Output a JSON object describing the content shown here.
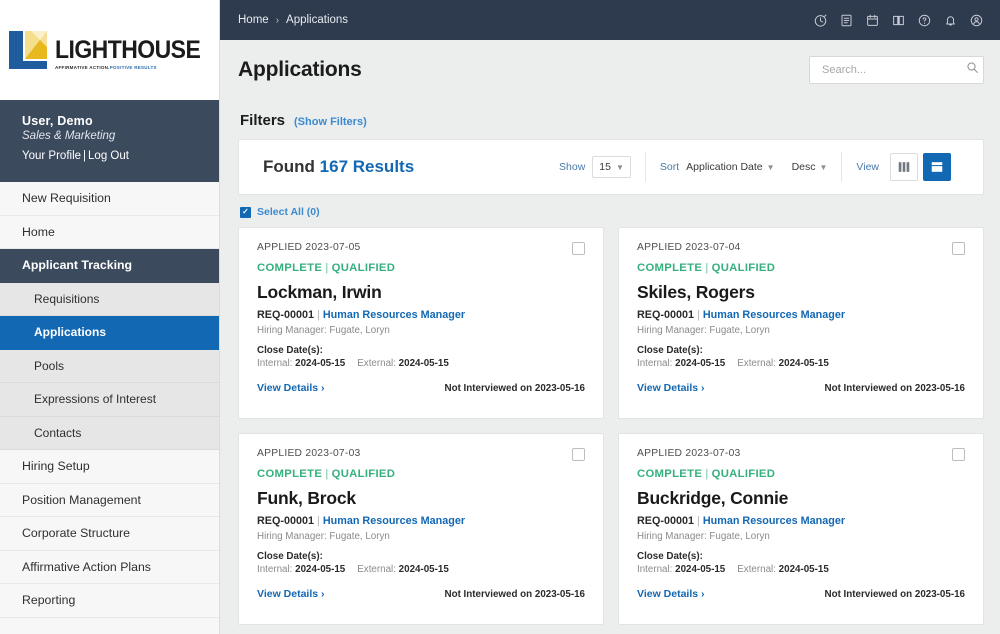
{
  "brand": {
    "word": "LIGHTHOUSE",
    "tagline_dark": "AFFIRMATIVE ACTION.",
    "tagline_blue": "POSITIVE RESULTS",
    "logo_icon": "lighthouse-logo-icon",
    "colors": {
      "navy": "#3c4a5e",
      "blue": "#1268b3",
      "gold": "#e8b81f",
      "green": "#35b07e"
    }
  },
  "user": {
    "name": "User, Demo",
    "department": "Sales & Marketing",
    "profile_link": "Your Profile",
    "separator": "|",
    "logout_link": "Log Out"
  },
  "sidebar": {
    "items": [
      {
        "label": "New Requisition",
        "type": "top",
        "state": "normal"
      },
      {
        "label": "Home",
        "type": "top",
        "state": "normal"
      },
      {
        "label": "Applicant Tracking",
        "type": "top",
        "state": "section-active"
      },
      {
        "label": "Requisitions",
        "type": "sub",
        "state": "normal"
      },
      {
        "label": "Applications",
        "type": "sub",
        "state": "active"
      },
      {
        "label": "Pools",
        "type": "sub",
        "state": "normal"
      },
      {
        "label": "Expressions of Interest",
        "type": "sub",
        "state": "normal"
      },
      {
        "label": "Contacts",
        "type": "sub",
        "state": "normal"
      },
      {
        "label": "Hiring Setup",
        "type": "top",
        "state": "normal"
      },
      {
        "label": "Position Management",
        "type": "top",
        "state": "normal"
      },
      {
        "label": "Corporate Structure",
        "type": "top",
        "state": "normal"
      },
      {
        "label": "Affirmative Action Plans",
        "type": "top",
        "state": "normal"
      },
      {
        "label": "Reporting",
        "type": "top",
        "state": "normal"
      }
    ]
  },
  "topbar": {
    "breadcrumb": [
      "Home",
      "Applications"
    ],
    "separator": "›",
    "icons": [
      "timer-icon",
      "documents-icon",
      "calendar-icon",
      "book-icon",
      "help-circle-icon",
      "bell-icon",
      "account-settings-icon"
    ]
  },
  "page": {
    "title": "Applications"
  },
  "search": {
    "placeholder": "Search...",
    "value": "",
    "icon": "search-icon"
  },
  "filters": {
    "label": "Filters",
    "toggle": "(Show Filters)"
  },
  "results": {
    "found_label": "Found",
    "count_label": "167 Results",
    "show_label": "Show",
    "show_value": "15",
    "sort_label": "Sort",
    "sort_value": "Application Date",
    "order_value": "Desc",
    "view_label": "View",
    "view_list_icon": "list-view-icon",
    "view_grid_icon": "grid-view-icon",
    "view_active": "grid"
  },
  "select_all": {
    "label": "Select All (0)",
    "checked": true
  },
  "cards": [
    {
      "applied": "APPLIED 2023-07-05",
      "status_complete": "COMPLETE",
      "status_sep": "|",
      "status_qualified": "QUALIFIED",
      "name": "Lockman, Irwin",
      "req_id": "REQ-00001",
      "req_title": "Human Resources Manager",
      "hiring_manager": "Hiring Manager: Fugate, Loryn",
      "close_label": "Close Date(s):",
      "internal_label": "Internal:",
      "internal_date": "2024-05-15",
      "external_label": "External:",
      "external_date": "2024-05-15",
      "view_details": "View Details ›",
      "interview_note": "Not Interviewed on 2023-05-16"
    },
    {
      "applied": "APPLIED 2023-07-04",
      "status_complete": "COMPLETE",
      "status_sep": "|",
      "status_qualified": "QUALIFIED",
      "name": "Skiles, Rogers",
      "req_id": "REQ-00001",
      "req_title": "Human Resources Manager",
      "hiring_manager": "Hiring Manager: Fugate, Loryn",
      "close_label": "Close Date(s):",
      "internal_label": "Internal:",
      "internal_date": "2024-05-15",
      "external_label": "External:",
      "external_date": "2024-05-15",
      "view_details": "View Details ›",
      "interview_note": "Not Interviewed on 2023-05-16"
    },
    {
      "applied": "APPLIED 2023-07-03",
      "status_complete": "COMPLETE",
      "status_sep": "|",
      "status_qualified": "QUALIFIED",
      "name": "Funk, Brock",
      "req_id": "REQ-00001",
      "req_title": "Human Resources Manager",
      "hiring_manager": "Hiring Manager: Fugate, Loryn",
      "close_label": "Close Date(s):",
      "internal_label": "Internal:",
      "internal_date": "2024-05-15",
      "external_label": "External:",
      "external_date": "2024-05-15",
      "view_details": "View Details ›",
      "interview_note": "Not Interviewed on 2023-05-16"
    },
    {
      "applied": "APPLIED 2023-07-03",
      "status_complete": "COMPLETE",
      "status_sep": "|",
      "status_qualified": "QUALIFIED",
      "name": "Buckridge, Connie",
      "req_id": "REQ-00001",
      "req_title": "Human Resources Manager",
      "hiring_manager": "Hiring Manager: Fugate, Loryn",
      "close_label": "Close Date(s):",
      "internal_label": "Internal:",
      "internal_date": "2024-05-15",
      "external_label": "External:",
      "external_date": "2024-05-15",
      "view_details": "View Details ›",
      "interview_note": "Not Interviewed on 2023-05-16"
    }
  ]
}
